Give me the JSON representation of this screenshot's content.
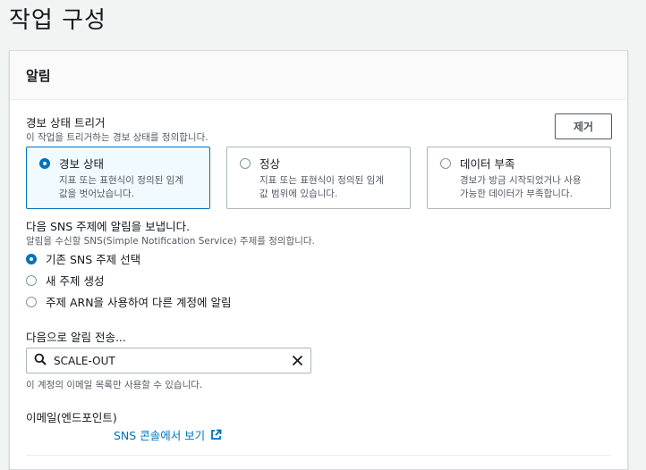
{
  "page": {
    "title": "작업 구성"
  },
  "panel": {
    "title": "알림"
  },
  "trigger": {
    "label": "경보 상태 트리거",
    "description": "이 작업을 트리거하는 경보 상태를 정의합니다.",
    "remove_label": "제거",
    "options": [
      {
        "title": "경보 상태",
        "desc_line1": "지표 또는 표현식이 정의된 임계",
        "desc_line2": "값을 벗어났습니다.",
        "selected": true
      },
      {
        "title": "정상",
        "desc_line1": "지표 또는 표현식이 정의된 임계",
        "desc_line2": "값 범위에 있습니다.",
        "selected": false
      },
      {
        "title": "데이터 부족",
        "desc_line1": "경보가 방금 시작되었거나 사용",
        "desc_line2": "가능한 데이터가 부족합니다.",
        "selected": false
      }
    ]
  },
  "sns": {
    "label": "다음 SNS 주제에 알림을 보냅니다.",
    "description": "알림을 수신할 SNS(Simple Notification Service) 주제를 정의합니다.",
    "options": [
      {
        "label": "기존 SNS 주제 선택",
        "selected": true
      },
      {
        "label": "새 주제 생성",
        "selected": false
      },
      {
        "label": "주제 ARN을 사용하여 다른 계정에 알림",
        "selected": false
      }
    ]
  },
  "send_to": {
    "label": "다음으로 알림 전송...",
    "value": "SCALE-OUT",
    "hint": "이 계정의 이메일 목록만 사용할 수 있습니다."
  },
  "endpoint": {
    "label": "이메일(엔드포인트)",
    "link_label": "SNS 콘솔에서 보기"
  },
  "colors": {
    "accent": "#0073bb",
    "text": "#16191f",
    "muted": "#545b64",
    "background": "#f2f3f3"
  },
  "icons": {
    "search": "search-icon",
    "clear": "close-icon",
    "external": "external-link-icon"
  }
}
